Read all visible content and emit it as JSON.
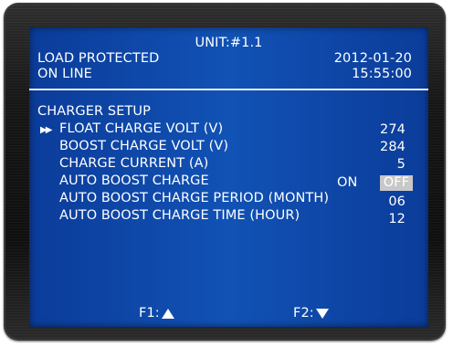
{
  "header": {
    "unit": "UNIT:#1.1",
    "status_line1": "LOAD PROTECTED",
    "status_line2": "ON LINE",
    "date": "2012-01-20",
    "time": "15:55:00"
  },
  "menu": {
    "title": "CHARGER SETUP",
    "cursor_icon": "double-right-arrow-icon",
    "items": [
      {
        "label": "FLOAT CHARGE VOLT (V)",
        "value": "274"
      },
      {
        "label": "BOOST CHARGE VOLT (V)",
        "value": "284"
      },
      {
        "label": "CHARGE CURRENT (A)",
        "value": "5"
      },
      {
        "label": "AUTO BOOST CHARGE",
        "option_on": "ON",
        "option_off": "OFF",
        "selected": "OFF"
      },
      {
        "label": "AUTO BOOST CHARGE PERIOD (MONTH)",
        "value": "06"
      },
      {
        "label": "AUTO BOOST CHARGE TIME (HOUR)",
        "value": "12"
      }
    ]
  },
  "footer": {
    "f1_label": "F1:",
    "f1_icon": "triangle-up-icon",
    "f2_label": "F2:",
    "f2_icon": "triangle-down-icon"
  },
  "colors": {
    "screen_bg": "#1152b5",
    "text": "#ffffff",
    "highlight_bg": "#c8c8c8",
    "bezel": "#161616"
  }
}
